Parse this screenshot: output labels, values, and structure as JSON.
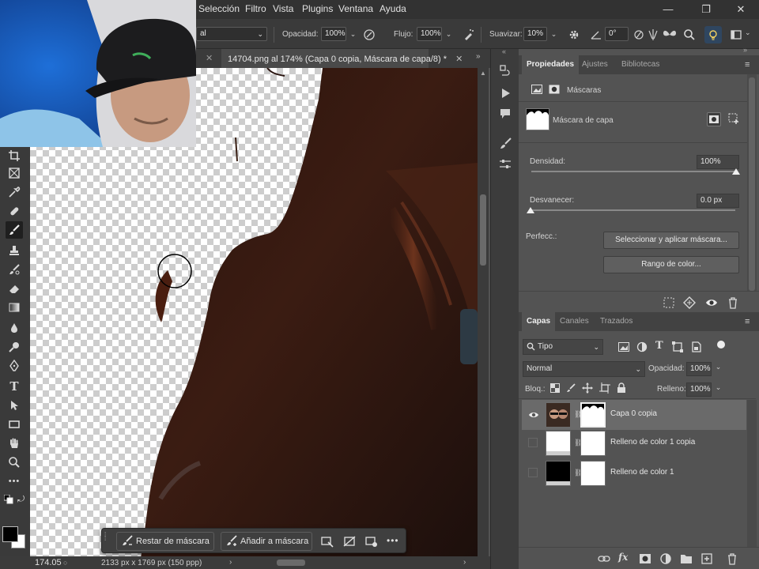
{
  "app": {
    "menu": [
      "Selección",
      "Filtro",
      "Vista",
      "Plugins",
      "Ventana",
      "Ayuda"
    ],
    "window_buttons": [
      "—",
      "❐",
      "✕"
    ]
  },
  "options_bar": {
    "mode_value": "al",
    "opacity_label": "Opacidad:",
    "opacity_value": "100%",
    "flow_label": "Flujo:",
    "flow_value": "100%",
    "smoothing_label": "Suavizar:",
    "smoothing_value": "10%",
    "angle_value": "0°"
  },
  "document": {
    "tab_title": "14704.png al 174% (Capa 0 copia, Máscara de capa/8) *",
    "zoom": "174.05",
    "dimensions": "2133 px x 1769 px (150 ppp)"
  },
  "task_bar": {
    "subtract_label": "Restar de máscara",
    "add_label": "Añadir a máscara"
  },
  "properties": {
    "tabs": [
      "Propiedades",
      "Ajustes",
      "Bibliotecas"
    ],
    "section_title": "Máscaras",
    "mask_name": "Máscara de capa",
    "density_label": "Densidad:",
    "density_value": "100%",
    "feather_label": "Desvanecer:",
    "feather_value": "0.0 px",
    "refine_label": "Perfecc.:",
    "select_mask_button": "Seleccionar y aplicar máscara...",
    "color_range_button": "Rango de color..."
  },
  "layers_panel": {
    "tabs": [
      "Capas",
      "Canales",
      "Trazados"
    ],
    "filter_value": "Tipo",
    "blend_mode": "Normal",
    "opacity_label": "Opacidad:",
    "opacity_value": "100%",
    "lock_label": "Bloq.:",
    "fill_label": "Relleno:",
    "fill_value": "100%",
    "layers": [
      {
        "name": "Capa 0 copia",
        "visible": true,
        "selected": true
      },
      {
        "name": "Relleno de color 1 copia",
        "visible": false,
        "selected": false
      },
      {
        "name": "Relleno de color 1",
        "visible": false,
        "selected": false
      }
    ]
  },
  "colors": {
    "accent": "#3a7bd5",
    "panel_bg": "#535353",
    "dark_bg": "#323232",
    "hair": "#3b1c12"
  }
}
